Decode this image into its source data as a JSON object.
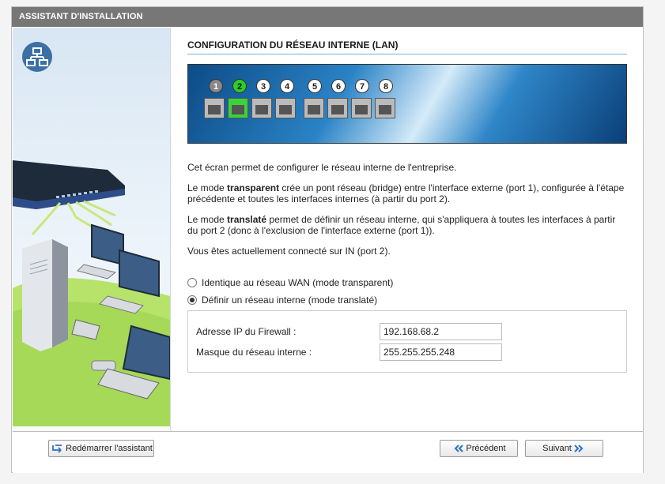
{
  "window": {
    "title": "ASSISTANT D'INSTALLATION"
  },
  "main": {
    "title": "CONFIGURATION DU RÉSEAU INTERNE (LAN)",
    "port_numbers": [
      "1",
      "2",
      "3",
      "4",
      "5",
      "6",
      "7",
      "8"
    ],
    "intro": "Cet écran permet de configurer le réseau interne de l'entreprise.",
    "transparent_prefix": "Le mode ",
    "transparent_bold": "transparent",
    "transparent_rest": " crée un pont réseau (bridge) entre l'interface externe (port 1), configurée à l'étape précédente et toutes les interfaces internes (à partir du port 2).",
    "translated_prefix": "Le mode ",
    "translated_bold": "translaté",
    "translated_rest": " permet de définir un réseau interne, qui s'appliquera à toutes les interfaces à partir du port 2 (donc à l'exclusion de l'interface externe (port 1)).",
    "connected": "Vous êtes actuellement connecté sur IN (port 2).",
    "radio_transparent": "Identique au réseau WAN (mode transparent)",
    "radio_translated": "Définir un réseau interne (mode translaté)",
    "selected_mode": "translated",
    "ip_label": "Adresse IP du Firewall :",
    "ip_value": "192.168.68.2",
    "mask_label": "Masque du réseau interne :",
    "mask_value": "255.255.255.248"
  },
  "footer": {
    "restart_label": "Redémarrer l'assistant",
    "previous_label": "Précédent",
    "next_label": "Suivant"
  },
  "colors": {
    "titlebar": "#777777",
    "accent": "#7ab0d8",
    "active_port": "#2ad02a"
  }
}
